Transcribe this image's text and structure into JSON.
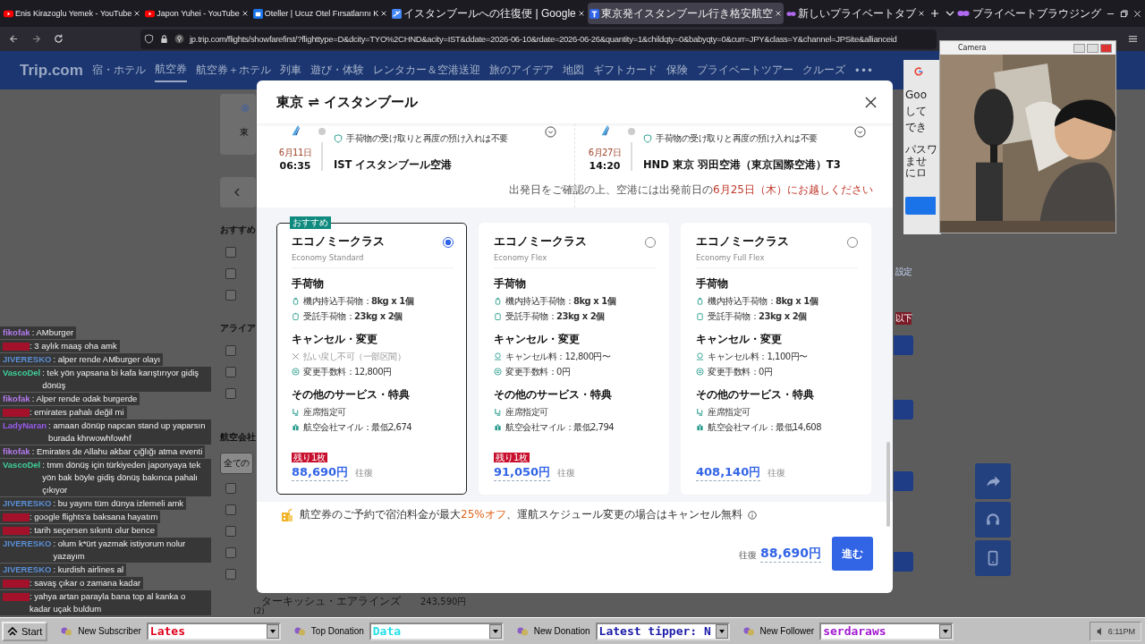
{
  "browser": {
    "tabs": [
      {
        "title": "Enis Kirazoglu Yemek - YouTube",
        "kind": "video",
        "selected": false
      },
      {
        "title": "Japon Yuhei - YouTube",
        "kind": "video",
        "selected": false
      },
      {
        "title": "Oteller | Ucuz Otel Fırsatlarını K",
        "kind": "hotel",
        "selected": false
      },
      {
        "title": "イスタンブールへの往復便 | Google",
        "kind": "flights",
        "selected": false
      },
      {
        "title": "東京発イスタンブール行き格安航空",
        "kind": "trip",
        "selected": true
      },
      {
        "title": "新しいプライベートタブ",
        "kind": "private",
        "selected": false
      }
    ],
    "private_label": "プライベートブラウジング",
    "url": "jp.trip.com/flights/showfarefirst/?flighttype=D&dcity=TYO%2CHND&acity=IST&ddate=2026-06-10&rdate=2026-06-26&quantity=1&childqty=0&babyqty=0&curr=JPY&class=Y&channel=JPSite&allianceid"
  },
  "site": {
    "logo": "Trip.com",
    "nav": [
      {
        "label": "宿・ホテル",
        "selected": false
      },
      {
        "label": "航空券",
        "selected": true
      },
      {
        "label": "航空券＋ホテル",
        "selected": false
      },
      {
        "label": "列車",
        "selected": false
      },
      {
        "label": "遊び・体験",
        "selected": false
      },
      {
        "label": "レンタカー＆空港送迎",
        "selected": false
      },
      {
        "label": "旅のアイデア",
        "selected": false
      },
      {
        "label": "地図",
        "selected": false
      },
      {
        "label": "ギフトカード",
        "selected": false
      },
      {
        "label": "保険",
        "selected": false
      },
      {
        "label": "プライベートツアー",
        "selected": false
      },
      {
        "label": "クルーズ",
        "selected": false
      },
      {
        "label": "•••",
        "selected": false
      }
    ],
    "top_card": {
      "text": "東",
      "selected": true
    },
    "filters": [
      {
        "heading": "おすすめ",
        "options": [
          {
            "checked": false
          },
          {
            "checked": false
          },
          {
            "checked": false
          }
        ]
      },
      {
        "heading": "アライア",
        "options": [
          {
            "checked": false
          },
          {
            "checked": false
          },
          {
            "checked": false
          }
        ]
      }
    ],
    "airline_heading": "航空会社",
    "airline_field": "全ての",
    "airline_options": [
      {
        "checked": false
      },
      {
        "checked": false
      },
      {
        "checked": false
      },
      {
        "checked": false
      },
      {
        "checked": false
      }
    ],
    "airline_row": {
      "name": "ターキッシュ・エアラインズ",
      "price": "243,590円",
      "count": "(2)"
    },
    "right_link": "設定",
    "right_tag": "以下",
    "google_popup": [
      "Goo",
      "して",
      "でき",
      "パスワ",
      "ませ",
      "にロ"
    ]
  },
  "modal": {
    "from": "東京",
    "arrow": "⇌",
    "to": "イスタンブール",
    "segments": [
      {
        "note": "手荷物の受け取りと再度の預け入れは不要",
        "date": "6月11日",
        "time": "06:35",
        "airport": "IST イスタンブール空港"
      },
      {
        "note": "手荷物の受け取りと再度の預け入れは不要",
        "date": "6月27日",
        "time": "14:20",
        "airport": "HND 東京 羽田空港（東京国際空港）T3"
      }
    ],
    "notice": {
      "text": "出発日をご確認の上、空港には出発前日の",
      "highlight": "6月25日（木）にお越しください"
    },
    "fares": [
      {
        "ribbon": "おすすめ",
        "name": "エコノミークラス",
        "sub": "Economy Standard",
        "selected": true,
        "sections": [
          {
            "heading": "手荷物",
            "items": [
              {
                "kind": "carry-on",
                "text": "機内持込手荷物：**8kg x 1個**",
                "disabled": false
              },
              {
                "kind": "checked-bag",
                "text": "受託手荷物：**23kg x 2個**",
                "disabled": false
              }
            ]
          },
          {
            "heading": "キャンセル・変更",
            "items": [
              {
                "kind": "unavailable",
                "text": "払い戻し不可（一部区間）",
                "disabled": true
              },
              {
                "kind": "change",
                "text": "変更手数料：12,800円",
                "disabled": false
              }
            ]
          },
          {
            "heading": "その他のサービス・特典",
            "items": [
              {
                "kind": "seat",
                "text": "座席指定可",
                "disabled": false
              },
              {
                "kind": "miles",
                "text": "航空会社マイル：最低2,674",
                "disabled": false
              }
            ]
          }
        ],
        "remaining": "残り1枚",
        "price": "88,690円",
        "trip": "往復"
      },
      {
        "name": "エコノミークラス",
        "sub": "Economy Flex",
        "selected": false,
        "sections": [
          {
            "heading": "手荷物",
            "items": [
              {
                "kind": "carry-on",
                "text": "機内持込手荷物：**8kg x 1個**",
                "disabled": false
              },
              {
                "kind": "checked-bag",
                "text": "受託手荷物：**23kg x 2個**",
                "disabled": false
              }
            ]
          },
          {
            "heading": "キャンセル・変更",
            "items": [
              {
                "kind": "refund",
                "text": "キャンセル料：12,800円〜",
                "disabled": false
              },
              {
                "kind": "change",
                "text": "変更手数料：0円",
                "disabled": false
              }
            ]
          },
          {
            "heading": "その他のサービス・特典",
            "items": [
              {
                "kind": "seat",
                "text": "座席指定可",
                "disabled": false
              },
              {
                "kind": "miles",
                "text": "航空会社マイル：最低2,794",
                "disabled": false
              }
            ]
          }
        ],
        "remaining": "残り1枚",
        "price": "91,050円",
        "trip": "往復"
      },
      {
        "name": "エコノミークラス",
        "sub": "Economy Full Flex",
        "selected": false,
        "sections": [
          {
            "heading": "手荷物",
            "items": [
              {
                "kind": "carry-on",
                "text": "機内持込手荷物：**8kg x 1個**",
                "disabled": false
              },
              {
                "kind": "checked-bag",
                "text": "受託手荷物：**23kg x 2個**",
                "disabled": false
              }
            ]
          },
          {
            "heading": "キャンセル・変更",
            "items": [
              {
                "kind": "refund",
                "text": "キャンセル料：1,100円〜",
                "disabled": false
              },
              {
                "kind": "change",
                "text": "変更手数料：0円",
                "disabled": false
              }
            ]
          },
          {
            "heading": "その他のサービス・特典",
            "items": [
              {
                "kind": "seat",
                "text": "座席指定可",
                "disabled": false
              },
              {
                "kind": "miles",
                "text": "航空会社マイル：最低14,608",
                "disabled": false
              }
            ]
          }
        ],
        "price": "408,140円",
        "trip": "往復"
      }
    ],
    "promo": {
      "before": "航空券のご予約で宿泊料金が最大",
      "highlight": "25%オフ",
      "after": "、運航スケジュール変更の場合はキャンセル無料"
    },
    "total": {
      "label": "往復",
      "price": "88,690円"
    },
    "proceed": "進む"
  },
  "chat": [
    {
      "user": "fikofak",
      "color": "#b57bee",
      "redacted": false,
      "text": ": AMburger"
    },
    {
      "color": "#a3122a",
      "redacted": true,
      "text": ": 3 aylık maaş oha amk"
    },
    {
      "user": "JIVERESKO",
      "color": "#5b8fd8",
      "redacted": false,
      "text": ": alper rende AMburger olayı"
    },
    {
      "user": "VascoDel",
      "color": "#3ecf9a",
      "redacted": false,
      "text": ": tek yön yapsana bi kafa karıştırıyor gidiş dönüş"
    },
    {
      "user": "fikofak",
      "color": "#b57bee",
      "redacted": false,
      "text": ": Alper rende odak burgerde"
    },
    {
      "color": "#a3122a",
      "redacted": true,
      "text": ": emirates pahalı değil mi"
    },
    {
      "user": "LadyNaran",
      "color": "#9a5cf0",
      "redacted": false,
      "text": ": amaan dönüp napcan stand up yaparsın burada khrwowhfowhf"
    },
    {
      "user": "fikofak",
      "color": "#b57bee",
      "redacted": false,
      "text": ": Emirates de Allahu akbar çığlığı atma eventi"
    },
    {
      "user": "VascoDel",
      "color": "#3ecf9a",
      "redacted": false,
      "text": ": tmm dönüş için türkiyeden japonyaya tek yön bak böyle gidiş dönüş bakınca pahalı çıkıyor"
    },
    {
      "user": "JIVERESKO",
      "color": "#5b8fd8",
      "redacted": false,
      "text": ": bu yayını tüm dünya izlemeli amk"
    },
    {
      "color": "#a3122a",
      "redacted": true,
      "text": ": google flights'a baksana hayatım"
    },
    {
      "color": "#a3122a",
      "redacted": true,
      "text": ": tarih seçersen sıkıntı olur bence"
    },
    {
      "user": "JIVERESKO",
      "color": "#5b8fd8",
      "redacted": false,
      "text": ": olum k*ürt yazmak istiyorum nolur yazayım"
    },
    {
      "user": "JIVERESKO",
      "color": "#5b8fd8",
      "redacted": false,
      "text": ": kurdish airlines al"
    },
    {
      "color": "#a3122a",
      "redacted": true,
      "text": ": savaş çıkar o zamana kadar"
    },
    {
      "color": "#a3122a",
      "redacted": true,
      "text": ": yahya artan parayla bana top al kanka o kadar uçak buldum"
    }
  ],
  "webcam": {
    "title": "Camera",
    "kind": "picture"
  },
  "taskbar": {
    "start": "Start",
    "items": [
      {
        "label": "New Subscriber",
        "field": "Lates",
        "color": "#e0001b"
      },
      {
        "label": "Top Donation",
        "field": "Data",
        "color": "#22e0e8"
      },
      {
        "label": "New Donation",
        "field": "Latest tipper: N",
        "color": "#1a1aa8"
      },
      {
        "label": "New Follower",
        "field": "serdaraws",
        "color": "#a21ad0"
      }
    ],
    "time": "6:11PM"
  }
}
